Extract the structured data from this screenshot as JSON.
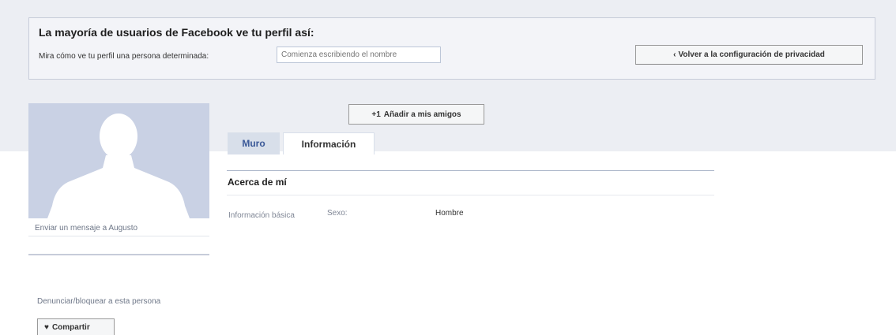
{
  "preview": {
    "title": "La mayoría de usuarios de Facebook ve tu perfil así:",
    "person_label": "Mira cómo ve tu perfil una persona determinada:",
    "person_placeholder": "Comienza escribiendo el nombre",
    "back_button_icon": "‹",
    "back_button_label": "Volver a la configuración de privacidad"
  },
  "profile": {
    "send_message": "Enviar un mensaje a Augusto",
    "report_link": "Denunciar/bloquear a esta persona",
    "share_icon": "♥",
    "share_label": "Compartir",
    "avatar_icon": "silhouette-icon"
  },
  "actions": {
    "add_friend_icon": "+1",
    "add_friend_label": "Añadir a mis amigos"
  },
  "tabs": [
    {
      "label": "Muro"
    },
    {
      "label": "Información"
    }
  ],
  "about": {
    "title": "Acerca de mí",
    "section_label": "Información básica",
    "fields": [
      {
        "label": "Sexo:",
        "value": "Hombre"
      }
    ]
  },
  "colors": {
    "accent": "#3b5998",
    "tab_bg": "#d8dfea",
    "band_bg": "#eceef3",
    "avatar_bg": "#c9d1e4"
  }
}
